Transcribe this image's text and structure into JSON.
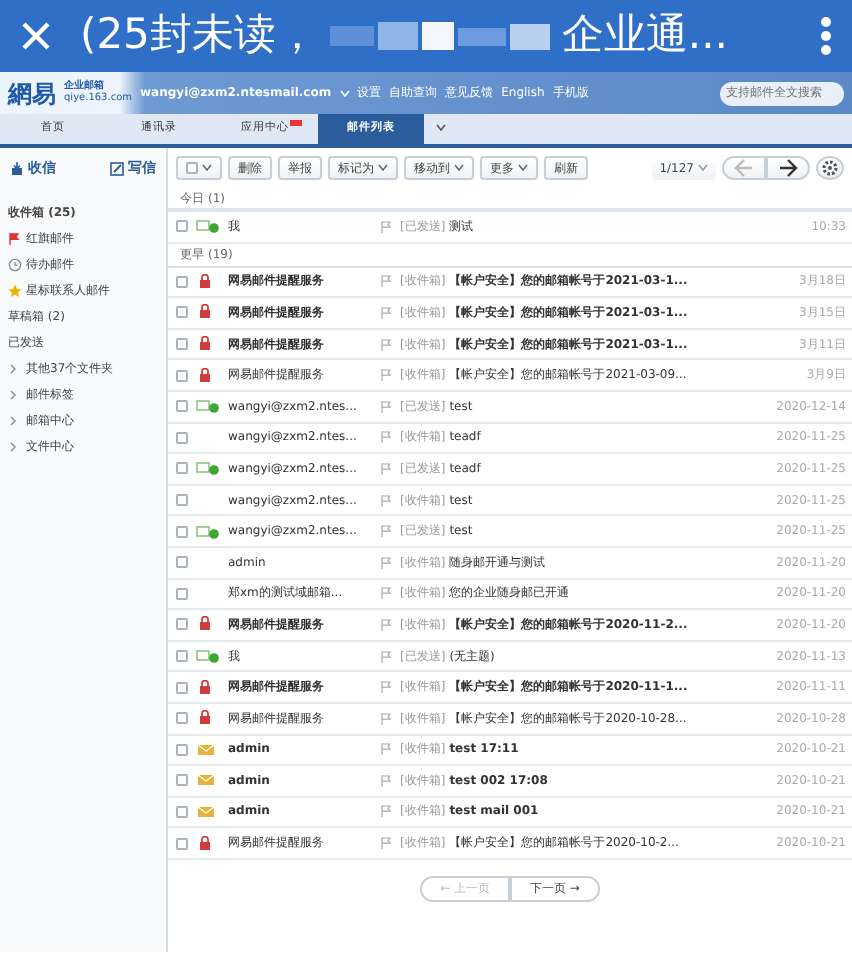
{
  "title_bar": {
    "title_start": "(25封未读，",
    "title_end": "企业通..."
  },
  "header": {
    "logo": "網易",
    "product": "企业邮箱",
    "domain": "qiye.163.com",
    "account": "wangyi@zxm2.ntesmail.com",
    "links": [
      "设置",
      "自助查询",
      "意见反馈",
      "English",
      "手机版"
    ],
    "search": {
      "placeholder": "支持邮件全文搜索"
    }
  },
  "tabs": [
    {
      "label": "首页",
      "selected": false,
      "badge": false
    },
    {
      "label": "通讯录",
      "selected": false,
      "badge": false
    },
    {
      "label": "应用中心",
      "selected": false,
      "badge": true
    },
    {
      "label": "邮件列表",
      "selected": true,
      "badge": false
    }
  ],
  "sidebar": {
    "receive": "收信",
    "compose": "写信",
    "items": [
      {
        "label": "收件箱 (25)",
        "kind": "plain",
        "bold": true
      },
      {
        "label": "红旗邮件",
        "kind": "flag",
        "bold": false
      },
      {
        "label": "待办邮件",
        "kind": "clock",
        "bold": false
      },
      {
        "label": "星标联系人邮件",
        "kind": "star",
        "bold": false
      },
      {
        "label": "草稿箱 (2)",
        "kind": "plain",
        "bold": false
      },
      {
        "label": "已发送",
        "kind": "plain",
        "bold": false
      },
      {
        "label": "其他37个文件夹",
        "kind": "folder",
        "bold": false
      },
      {
        "label": "邮件标签",
        "kind": "folder",
        "bold": false
      },
      {
        "label": "邮箱中心",
        "kind": "folder",
        "bold": false
      },
      {
        "label": "文件中心",
        "kind": "folder",
        "bold": false
      }
    ]
  },
  "toolbar": {
    "buttons": [
      {
        "label": "删除",
        "dropdown": false
      },
      {
        "label": "举报",
        "dropdown": false
      },
      {
        "label": "标记为",
        "dropdown": true
      },
      {
        "label": "移动到",
        "dropdown": true
      },
      {
        "label": "更多",
        "dropdown": true
      },
      {
        "label": "刷新",
        "dropdown": false
      }
    ],
    "page": "1/127",
    "checked": false
  },
  "groups": [
    {
      "label": "今日",
      "count": "(1)",
      "rows": [
        {
          "kind": "sent",
          "sender": "我",
          "tag": "[已发送]",
          "subject": "测试",
          "time": "10:33",
          "bold": false,
          "checked": false
        }
      ]
    },
    {
      "label": "更早",
      "count": "(19)",
      "rows": [
        {
          "kind": "lock",
          "sender": "网易邮件提醒服务",
          "tag": "[收件箱]",
          "subject": "【帐户安全】您的邮箱帐号于2021-03-1...",
          "time": "3月18日",
          "bold": true,
          "checked": false
        },
        {
          "kind": "lock",
          "sender": "网易邮件提醒服务",
          "tag": "[收件箱]",
          "subject": "【帐户安全】您的邮箱帐号于2021-03-1...",
          "time": "3月15日",
          "bold": true,
          "checked": false
        },
        {
          "kind": "lock",
          "sender": "网易邮件提醒服务",
          "tag": "[收件箱]",
          "subject": "【帐户安全】您的邮箱帐号于2021-03-1...",
          "time": "3月11日",
          "bold": true,
          "checked": false
        },
        {
          "kind": "lock",
          "sender": "网易邮件提醒服务",
          "tag": "[收件箱]",
          "subject": "【帐户安全】您的邮箱帐号于2021-03-09...",
          "time": "3月9日",
          "bold": false,
          "checked": false
        },
        {
          "kind": "sent",
          "sender": "wangyi@zxm2.ntes...",
          "tag": "[已发送]",
          "subject": "test",
          "time": "2020-12-14",
          "bold": false,
          "checked": false
        },
        {
          "kind": "none",
          "sender": "wangyi@zxm2.ntes...",
          "tag": "[收件箱]",
          "subject": "teadf",
          "time": "2020-11-25",
          "bold": false,
          "checked": false
        },
        {
          "kind": "sent",
          "sender": "wangyi@zxm2.ntes...",
          "tag": "[已发送]",
          "subject": "teadf",
          "time": "2020-11-25",
          "bold": false,
          "checked": false
        },
        {
          "kind": "none",
          "sender": "wangyi@zxm2.ntes...",
          "tag": "[收件箱]",
          "subject": "test",
          "time": "2020-11-25",
          "bold": false,
          "checked": false
        },
        {
          "kind": "sent",
          "sender": "wangyi@zxm2.ntes...",
          "tag": "[已发送]",
          "subject": "test",
          "time": "2020-11-25",
          "bold": false,
          "checked": false
        },
        {
          "kind": "none",
          "sender": "admin",
          "tag": "[收件箱]",
          "subject": "随身邮开通与测试",
          "time": "2020-11-20",
          "bold": false,
          "checked": false
        },
        {
          "kind": "none",
          "sender": "郑xm的测试域邮箱...",
          "tag": "[收件箱]",
          "subject": "您的企业随身邮已开通",
          "time": "2020-11-20",
          "bold": false,
          "checked": false
        },
        {
          "kind": "lock",
          "sender": "网易邮件提醒服务",
          "tag": "[收件箱]",
          "subject": "【帐户安全】您的邮箱帐号于2020-11-2...",
          "time": "2020-11-20",
          "bold": true,
          "checked": false
        },
        {
          "kind": "sent",
          "sender": "我",
          "tag": "[已发送]",
          "subject": "(无主题)",
          "time": "2020-11-13",
          "bold": false,
          "checked": false
        },
        {
          "kind": "lock",
          "sender": "网易邮件提醒服务",
          "tag": "[收件箱]",
          "subject": "【帐户安全】您的邮箱帐号于2020-11-1...",
          "time": "2020-11-11",
          "bold": true,
          "checked": false
        },
        {
          "kind": "lock",
          "sender": "网易邮件提醒服务",
          "tag": "[收件箱]",
          "subject": "【帐户安全】您的邮箱帐号于2020-10-28...",
          "time": "2020-10-28",
          "bold": false,
          "checked": false
        },
        {
          "kind": "unread",
          "sender": "admin",
          "tag": "[收件箱]",
          "subject": "test 17:11",
          "time": "2020-10-21",
          "bold": true,
          "checked": false
        },
        {
          "kind": "unread",
          "sender": "admin",
          "tag": "[收件箱]",
          "subject": "test 002 17:08",
          "time": "2020-10-21",
          "bold": true,
          "checked": false
        },
        {
          "kind": "unread",
          "sender": "admin",
          "tag": "[收件箱]",
          "subject": "test mail 001",
          "time": "2020-10-21",
          "bold": true,
          "checked": false
        },
        {
          "kind": "lock",
          "sender": "网易邮件提醒服务",
          "tag": "[收件箱]",
          "subject": "【帐户安全】您的邮箱帐号于2020-10-2...",
          "time": "2020-10-21",
          "bold": false,
          "checked": false
        }
      ]
    }
  ],
  "pager": [
    {
      "label": "← 上一页",
      "disabled": true
    },
    {
      "label": "下一页 →",
      "disabled": false
    }
  ]
}
